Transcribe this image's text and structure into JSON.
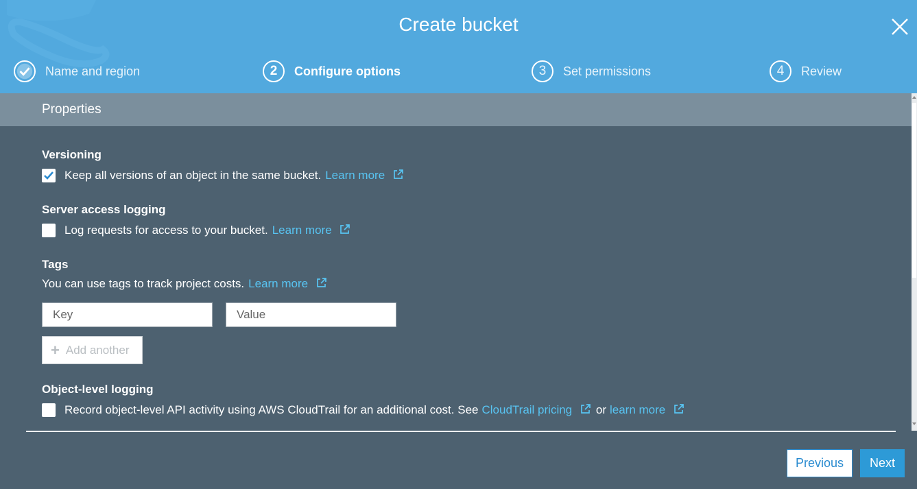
{
  "header": {
    "title": "Create bucket",
    "steps": [
      {
        "number": "",
        "label": "Name and region",
        "state": "done"
      },
      {
        "number": "2",
        "label": "Configure options",
        "state": "active"
      },
      {
        "number": "3",
        "label": "Set permissions",
        "state": "pending"
      },
      {
        "number": "4",
        "label": "Review",
        "state": "pending"
      }
    ]
  },
  "properties": {
    "heading": "Properties",
    "versioning": {
      "title": "Versioning",
      "text": "Keep all versions of an object in the same bucket.",
      "link": "Learn more",
      "checked": true
    },
    "logging": {
      "title": "Server access logging",
      "text": "Log requests for access to your bucket.",
      "link": "Learn more",
      "checked": false
    },
    "tags": {
      "title": "Tags",
      "text": "You can use tags to track project costs.",
      "link": "Learn more",
      "key_placeholder": "Key",
      "value_placeholder": "Value",
      "add_label": "Add another"
    },
    "object_logging": {
      "title": "Object-level logging",
      "text": "Record object-level API activity using AWS CloudTrail for an additional cost. See",
      "link1": "CloudTrail pricing",
      "connector": "or",
      "link2": "learn more",
      "checked": false
    }
  },
  "footer": {
    "previous_label": "Previous",
    "next_label": "Next"
  },
  "colors": {
    "header_bg": "#52a9de",
    "body_bg": "#4d6170",
    "properties_bar": "#7b8f9d",
    "link": "#58c4f2",
    "primary_button": "#2d9ad7"
  }
}
